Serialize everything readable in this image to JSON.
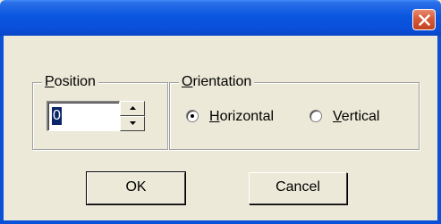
{
  "window": {
    "title": "",
    "close_icon": "close-icon"
  },
  "position_group": {
    "label_ul": "P",
    "label_rest": "osition",
    "spin_value": "0",
    "up_icon": "arrow-up-icon",
    "down_icon": "arrow-down-icon"
  },
  "orientation_group": {
    "label_ul": "O",
    "label_rest": "rientation",
    "options": [
      {
        "label_ul": "H",
        "label_rest": "orizontal",
        "selected": true
      },
      {
        "label_ul": "V",
        "label_rest": "ertical",
        "selected": false
      }
    ]
  },
  "buttons": {
    "ok": "OK",
    "cancel": "Cancel"
  },
  "colors": {
    "titlebar": "#0a56e0",
    "close": "#d65a3a",
    "face": "#ece9d8",
    "selection": "#0a246a"
  }
}
